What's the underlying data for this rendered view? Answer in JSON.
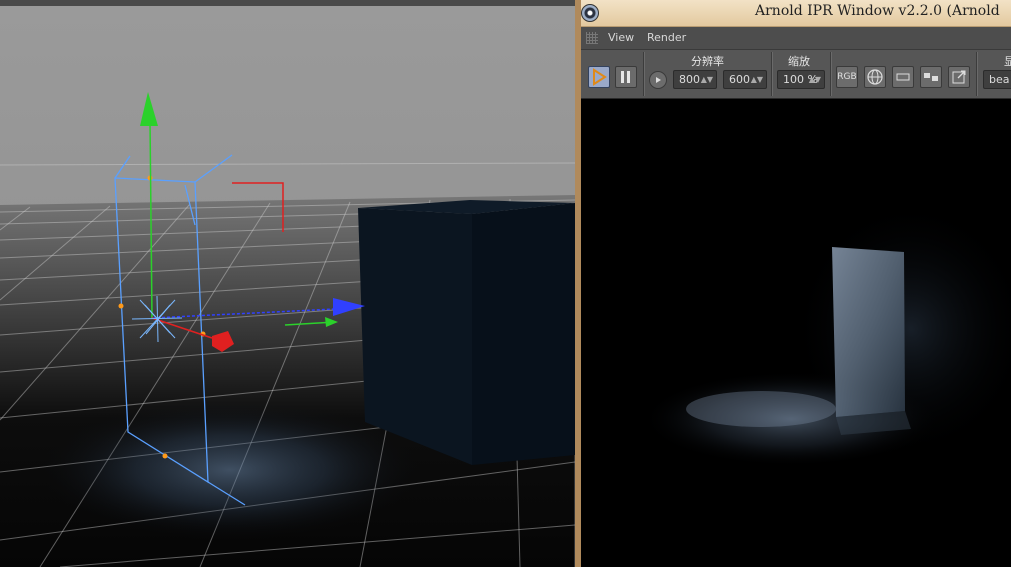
{
  "ipr": {
    "title": "Arnold IPR Window v2.2.0 (Arnold",
    "menu": [
      "View",
      "Render"
    ],
    "toolbar": {
      "resolution_label": "分辨率",
      "width": "800",
      "height": "600",
      "zoom_label": "缩放",
      "zoom": "100 %",
      "channel_button": "RGB",
      "display_label": "显",
      "aov": "bea"
    }
  },
  "colors": {
    "titlebar": "#e8d3ad",
    "accent_play": "#9aa9c9",
    "axis_y": "#2bd12b",
    "axis_x": "#3040ff",
    "axis_z": "#e02020",
    "light_gizmo": "#5aa0ff"
  },
  "icons": [
    "cinema4d-logo-icon",
    "grip-icon",
    "play-icon",
    "pause-icon",
    "small-play-icon",
    "globe-icon",
    "region-icon",
    "compare-icon",
    "export-icon"
  ]
}
